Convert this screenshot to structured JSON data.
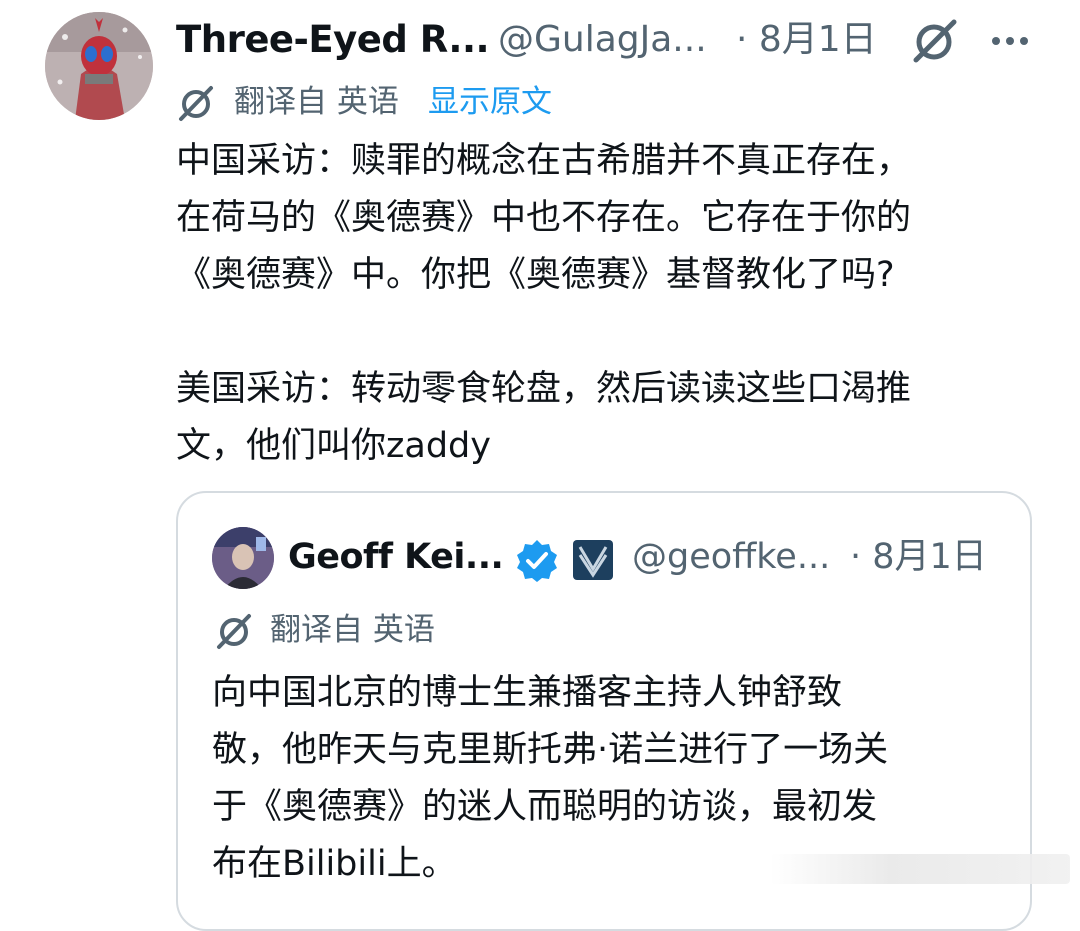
{
  "tweet": {
    "author": {
      "name": "Three-Eyed R...",
      "handle": "@GulagJa...",
      "date": "· 8月1日"
    },
    "translation": {
      "label": "翻译自 英语",
      "show_original": "显示原文"
    },
    "text": {
      "para1": [
        "中国采访：赎罪的概念在古希腊并不真正存在，",
        "在荷马的《奥德赛》中也不存在。它存在于你的",
        "《奥德赛》中。你把《奥德赛》基督教化了吗?"
      ],
      "para2": [
        "美国采访：转动零食轮盘，然后读读这些口渴推",
        "文，他们叫你zaddy"
      ]
    },
    "icons": {
      "grok": "grok-icon",
      "more": "more-icon"
    }
  },
  "quote": {
    "author": {
      "name": "Geoff Kei...",
      "handle": "@geoffke...",
      "date": "· 8月1日",
      "verified_icon": "verified-badge-icon",
      "affiliation_icon": "affiliation-badge-icon"
    },
    "translation": {
      "label": "翻译自 英语"
    },
    "text": [
      "向中国北京的博士生兼播客主持人钟舒致",
      "敬，他昨天与克里斯托弗·诺兰进行了一场关",
      "于《奥德赛》的迷人而聪明的访谈，最初发",
      "布在Bilibili上。"
    ]
  },
  "colors": {
    "text_primary": "#0f1419",
    "text_secondary": "#536471",
    "link_blue": "#1d9bf0",
    "border": "#d5dbe0"
  }
}
